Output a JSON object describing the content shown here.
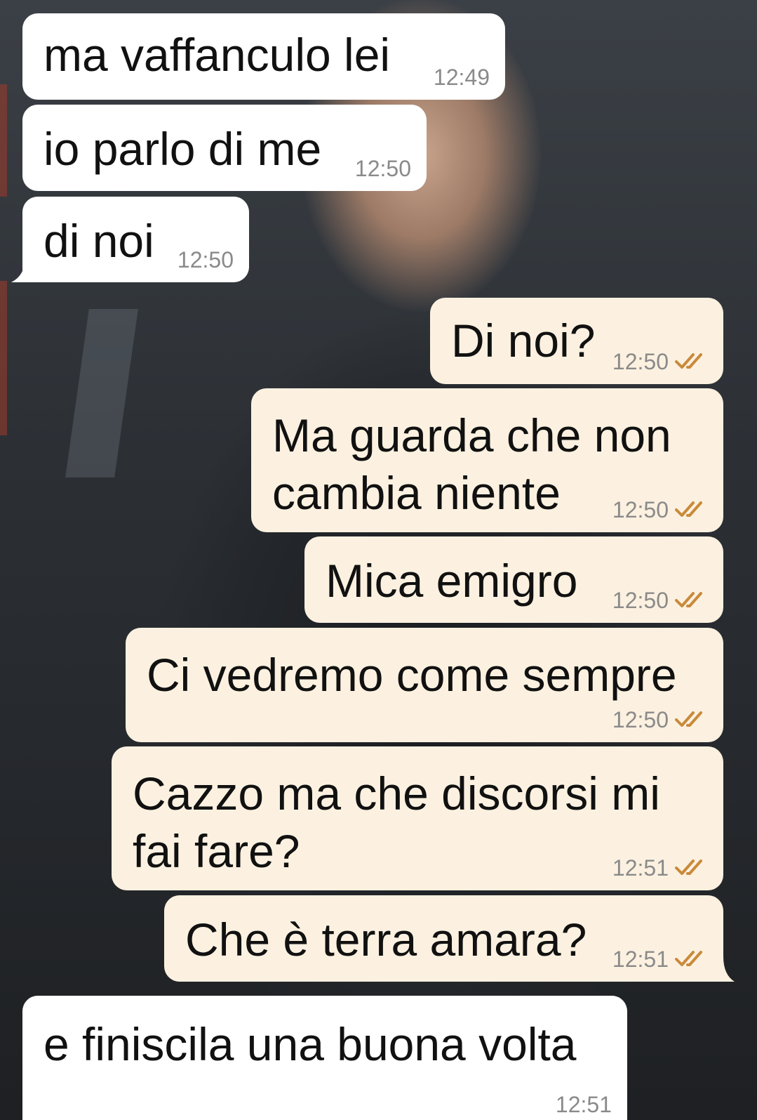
{
  "colors": {
    "incoming_bubble": "#ffffff",
    "outgoing_bubble": "#fcf1e0",
    "timestamp": "#8a8a8a",
    "read_ticks": "#c98a3b"
  },
  "messages": [
    {
      "direction": "incoming",
      "text": "ma vaffanculo lei",
      "time": "12:49"
    },
    {
      "direction": "incoming",
      "text": "io parlo di me",
      "time": "12:50"
    },
    {
      "direction": "incoming",
      "text": "di noi",
      "time": "12:50"
    },
    {
      "direction": "outgoing",
      "text": "Di noi?",
      "time": "12:50",
      "status_icon": "double-check-icon"
    },
    {
      "direction": "outgoing",
      "text": "Ma guarda che non\ncambia niente",
      "time": "12:50",
      "status_icon": "double-check-icon"
    },
    {
      "direction": "outgoing",
      "text": "Mica emigro",
      "time": "12:50",
      "status_icon": "double-check-icon"
    },
    {
      "direction": "outgoing",
      "text": "Ci vedremo come sempre",
      "time": "12:50",
      "status_icon": "double-check-icon"
    },
    {
      "direction": "outgoing",
      "text": "Cazzo ma che discorsi mi\nfai fare?",
      "time": "12:51",
      "status_icon": "double-check-icon"
    },
    {
      "direction": "outgoing",
      "text": "Che è terra amara?",
      "time": "12:51",
      "status_icon": "double-check-icon"
    },
    {
      "direction": "incoming",
      "text": "e finiscila una buona volta",
      "time": "12:51"
    }
  ]
}
